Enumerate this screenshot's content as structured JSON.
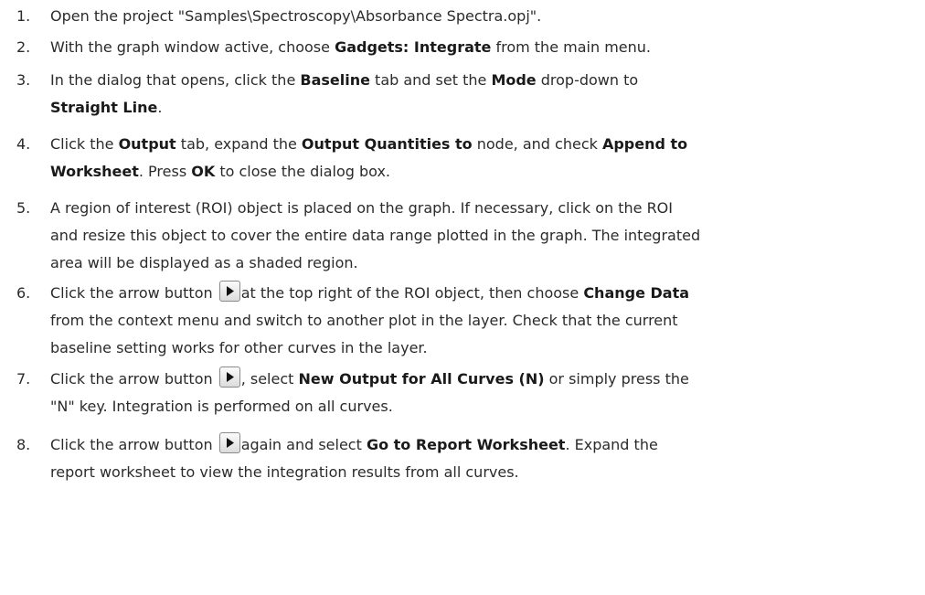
{
  "steps": [
    {
      "num": "1.",
      "lines": [
        [
          {
            "t": "Open the project \"Samples\\Spectroscopy\\Absorbance Spectra.opj\"."
          }
        ]
      ]
    },
    {
      "num": "2.",
      "lines": [
        [
          {
            "t": "With the graph window active, choose "
          },
          {
            "b": "Gadgets: Integrate"
          },
          {
            "t": " from the main menu."
          }
        ]
      ]
    },
    {
      "num": "3.",
      "lines": [
        [
          {
            "t": "In the dialog that opens, click the "
          },
          {
            "b": "Baseline"
          },
          {
            "t": " tab and set the "
          },
          {
            "b": "Mode"
          },
          {
            "t": " drop-down to"
          }
        ],
        [
          {
            "b": "Straight Line"
          },
          {
            "t": "."
          }
        ]
      ]
    },
    {
      "num": "4.",
      "lines": [
        [
          {
            "t": "Click the "
          },
          {
            "b": "Output"
          },
          {
            "t": " tab, expand the "
          },
          {
            "b": "Output Quantities to"
          },
          {
            "t": " node, and check "
          },
          {
            "b": "Append to"
          }
        ],
        [
          {
            "b": "Worksheet"
          },
          {
            "t": ". Press "
          },
          {
            "b": "OK"
          },
          {
            "t": " to close the dialog box."
          }
        ]
      ]
    },
    {
      "num": "5.",
      "lines": [
        [
          {
            "t": "A region of interest (ROI) object is placed on the graph. If necessary, click on the ROI"
          }
        ],
        [
          {
            "t": "and resize this object to cover the entire data range plotted in the graph. The integrated"
          }
        ],
        [
          {
            "t": "area will be displayed as a shaded region."
          }
        ]
      ]
    },
    {
      "num": "6.",
      "lines": [
        [
          {
            "t": "Click the arrow button "
          },
          {
            "icon": "arrow-button-icon"
          },
          {
            "t": "at the top right of the ROI object, then choose "
          },
          {
            "b": "Change Data"
          }
        ],
        [
          {
            "t": "from the context menu and switch to another plot in the layer. Check that the current"
          }
        ],
        [
          {
            "t": "baseline setting works for other curves in the layer."
          }
        ]
      ]
    },
    {
      "num": "7.",
      "lines": [
        [
          {
            "t": "Click the arrow button "
          },
          {
            "icon": "arrow-button-icon"
          },
          {
            "t": ", select "
          },
          {
            "b": "New Output for All Curves (N)"
          },
          {
            "t": " or simply press the"
          }
        ],
        [
          {
            "t": "\"N\" key. Integration is performed on all curves."
          }
        ]
      ]
    },
    {
      "num": "8.",
      "lines": [
        [
          {
            "t": "Click the arrow button "
          },
          {
            "icon": "arrow-button-icon"
          },
          {
            "t": "again and select "
          },
          {
            "b": "Go to Report Worksheet"
          },
          {
            "t": ". Expand the"
          }
        ],
        [
          {
            "t": "report worksheet to view the integration results from all curves."
          }
        ]
      ]
    }
  ]
}
